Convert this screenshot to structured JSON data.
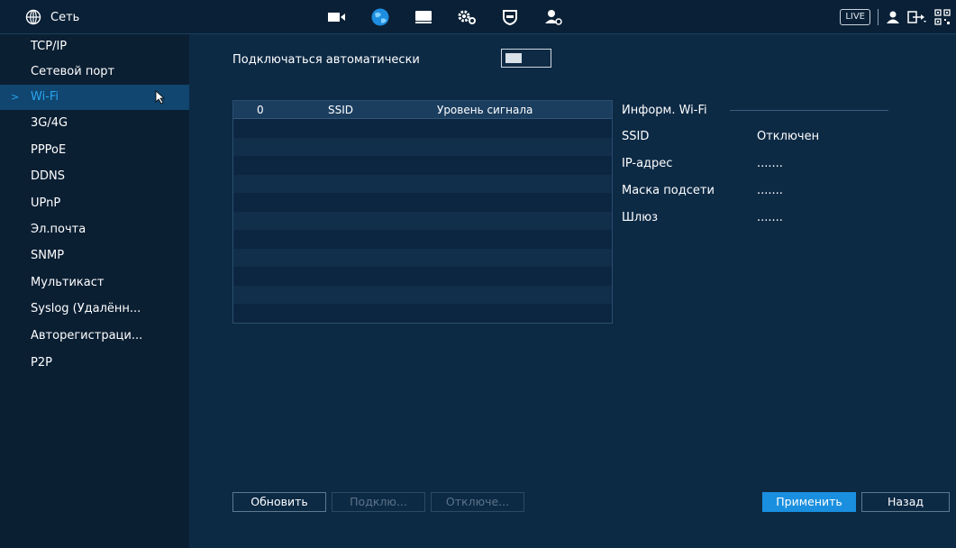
{
  "header": {
    "menu_title": "Сеть",
    "live_label": "LIVE",
    "nav_icons": [
      "camera-icon",
      "network-globe-icon",
      "storage-icon",
      "settings-gears-icon",
      "security-shield-icon",
      "account-icon"
    ],
    "right_icons": [
      "user-icon",
      "logout-icon",
      "qr-code-icon"
    ]
  },
  "sidebar": {
    "items": [
      {
        "label": "TCP/IP"
      },
      {
        "label": "Сетевой порт"
      },
      {
        "label": "Wi-Fi",
        "active": true
      },
      {
        "label": "3G/4G"
      },
      {
        "label": "PPPoE"
      },
      {
        "label": "DDNS"
      },
      {
        "label": "UPnP"
      },
      {
        "label": "Эл.почта"
      },
      {
        "label": "SNMP"
      },
      {
        "label": "Мультикаст"
      },
      {
        "label": "Syslog (Удалённ..."
      },
      {
        "label": "Авторегистраци..."
      },
      {
        "label": "P2P"
      }
    ]
  },
  "main": {
    "auto_connect_label": "Подключаться автоматически",
    "auto_connect_on": false,
    "table": {
      "columns": [
        "0",
        "SSID",
        "Уровень сигнала"
      ],
      "rows": []
    },
    "info": {
      "title": "Информ. Wi-Fi",
      "fields": [
        {
          "label": "SSID",
          "value": "Отключен"
        },
        {
          "label": "IP-адрес",
          "value": "......."
        },
        {
          "label": "Маска подсети",
          "value": "......."
        },
        {
          "label": "Шлюз",
          "value": "......."
        }
      ]
    }
  },
  "buttons": {
    "refresh": "Обновить",
    "connect": "Подклю...",
    "disconnect": "Отключе...",
    "apply": "Применить",
    "back": "Назад"
  },
  "colors": {
    "accent": "#2aa4f4",
    "primary_button": "#1a8fe0",
    "background": "#0d2a45"
  }
}
